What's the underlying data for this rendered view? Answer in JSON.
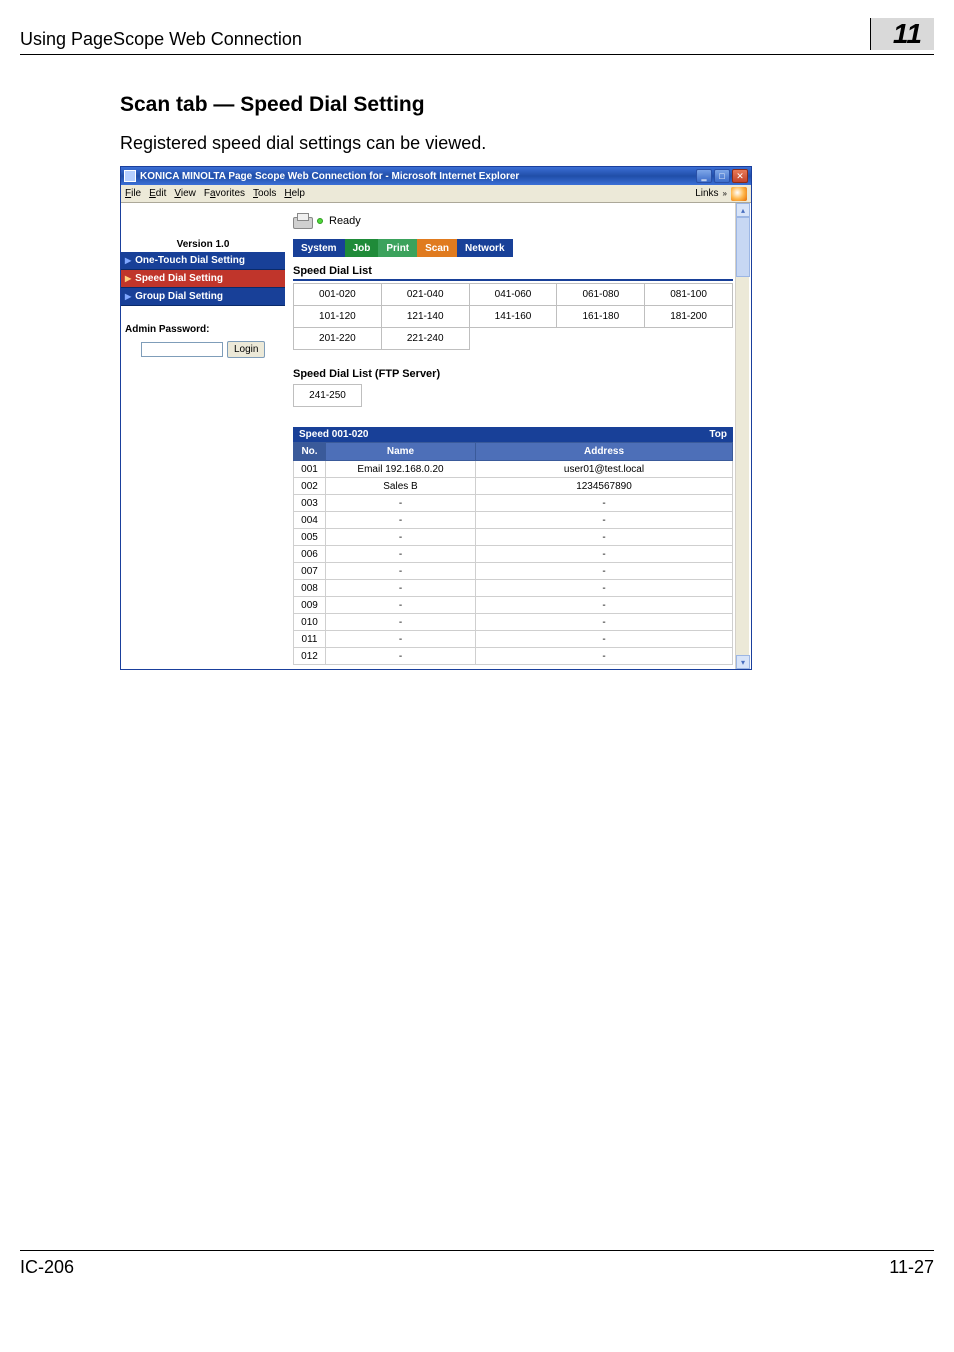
{
  "page": {
    "header_left": "Using PageScope Web Connection",
    "header_right": "11",
    "section_title": "Scan tab — Speed Dial Setting",
    "section_text": "Registered speed dial settings can be viewed.",
    "footer_left": "IC-206",
    "footer_right": "11-27"
  },
  "window": {
    "title": "KONICA MINOLTA Page Scope Web Connection for       - Microsoft Internet Explorer",
    "ie_menu": {
      "file": "File",
      "edit": "Edit",
      "view": "View",
      "favorites": "Favorites",
      "tools": "Tools",
      "help": "Help",
      "links": "Links"
    },
    "status_text": "Ready",
    "version": "Version 1.0",
    "sidebar": {
      "items": [
        {
          "label": "One-Touch Dial Setting"
        },
        {
          "label": "Speed Dial Setting"
        },
        {
          "label": "Group Dial Setting"
        }
      ]
    },
    "admin_label": "Admin Password:",
    "login_label": "Login",
    "tabs": {
      "system": "System",
      "job": "Job",
      "print": "Print",
      "scan": "Scan",
      "network": "Network"
    },
    "list_header": "Speed Dial List",
    "ranges": [
      [
        "001-020",
        "021-040",
        "041-060",
        "061-080",
        "081-100"
      ],
      [
        "101-120",
        "121-140",
        "141-160",
        "161-180",
        "181-200"
      ],
      [
        "201-220",
        "221-240",
        "",
        "",
        ""
      ]
    ],
    "ftp_header": "Speed Dial List (FTP Server)",
    "ftp_ranges": [
      "241-250"
    ],
    "speed_bar_left": "Speed 001-020",
    "speed_bar_right": "Top",
    "table": {
      "cols": {
        "no": "No.",
        "name": "Name",
        "address": "Address"
      },
      "rows": [
        {
          "no": "001",
          "name": "Email 192.168.0.20",
          "address": "user01@test.local"
        },
        {
          "no": "002",
          "name": "Sales B",
          "address": "1234567890"
        },
        {
          "no": "003",
          "name": "-",
          "address": "-"
        },
        {
          "no": "004",
          "name": "-",
          "address": "-"
        },
        {
          "no": "005",
          "name": "-",
          "address": "-"
        },
        {
          "no": "006",
          "name": "-",
          "address": "-"
        },
        {
          "no": "007",
          "name": "-",
          "address": "-"
        },
        {
          "no": "008",
          "name": "-",
          "address": "-"
        },
        {
          "no": "009",
          "name": "-",
          "address": "-"
        },
        {
          "no": "010",
          "name": "-",
          "address": "-"
        },
        {
          "no": "011",
          "name": "-",
          "address": "-"
        },
        {
          "no": "012",
          "name": "-",
          "address": "-"
        }
      ]
    }
  }
}
